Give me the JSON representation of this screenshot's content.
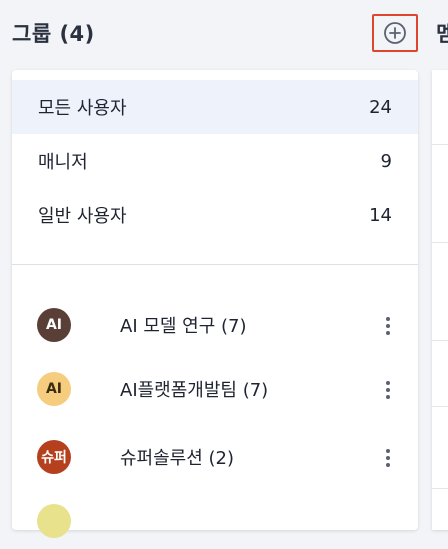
{
  "header": {
    "title": "그룹 (4)",
    "right_title_fragment": "멤"
  },
  "filters": [
    {
      "label": "모든 사용자",
      "count": "24",
      "selected": true
    },
    {
      "label": "매니저",
      "count": "9",
      "selected": false
    },
    {
      "label": "일반 사용자",
      "count": "14",
      "selected": false
    }
  ],
  "groups": [
    {
      "avatar": "AI",
      "avatar_bg": "#5a3f37",
      "avatar_fg": "#ffffff",
      "name": "AI 모델 연구 (7)"
    },
    {
      "avatar": "AI",
      "avatar_bg": "#f6cd7e",
      "avatar_fg": "#3a2c10",
      "name": "AI플랫폼개발팀 (7)"
    },
    {
      "avatar": "슈퍼",
      "avatar_bg": "#b5401e",
      "avatar_fg": "#ffffff",
      "name": "슈퍼솔루션 (2)"
    }
  ],
  "colors": {
    "highlight_border": "#e0452f",
    "selected_bg": "#eef2fa"
  }
}
